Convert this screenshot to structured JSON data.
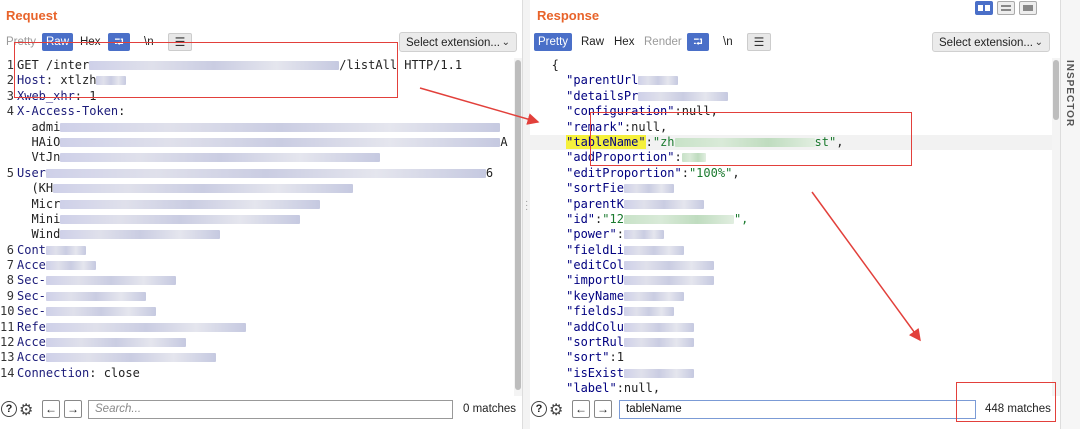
{
  "request": {
    "title": "Request",
    "tabs": [
      {
        "label": "Pretty",
        "state": "disabled"
      },
      {
        "label": "Raw",
        "state": "active"
      },
      {
        "label": "Hex",
        "state": "normal"
      }
    ],
    "newline_label": "\\n",
    "extension_select": "Select extension...",
    "lines": [
      {
        "n": "1",
        "parts": [
          {
            "t": "GET /inter"
          },
          {
            "b": 250
          },
          {
            "t": "/listAll HTTP/1.1"
          }
        ]
      },
      {
        "n": "2",
        "parts": [
          {
            "t": "Host",
            "c": "h"
          },
          {
            "t": ": xtlzh"
          },
          {
            "b": 30
          }
        ]
      },
      {
        "n": "3",
        "parts": [
          {
            "t": "Xweb_xhr",
            "c": "h"
          },
          {
            "t": ": 1"
          }
        ]
      },
      {
        "n": "4",
        "parts": [
          {
            "t": "X-Access-Token",
            "c": "h"
          },
          {
            "t": ":"
          }
        ]
      },
      {
        "n": "",
        "parts": [
          {
            "t": "  admi"
          },
          {
            "b": 440
          }
        ]
      },
      {
        "n": "",
        "parts": [
          {
            "t": "  HAiO"
          },
          {
            "b": 440
          },
          {
            "t": "A"
          }
        ]
      },
      {
        "n": "",
        "parts": [
          {
            "t": "  VtJn"
          },
          {
            "b": 320
          }
        ]
      },
      {
        "n": "5",
        "parts": [
          {
            "t": "User",
            "c": "h"
          },
          {
            "b": 440
          },
          {
            "t": "6"
          }
        ]
      },
      {
        "n": "",
        "parts": [
          {
            "t": "  (KH"
          },
          {
            "b": 300
          }
        ]
      },
      {
        "n": "",
        "parts": [
          {
            "t": "  Micr"
          },
          {
            "b": 260
          }
        ]
      },
      {
        "n": "",
        "parts": [
          {
            "t": "  Mini"
          },
          {
            "b": 240
          }
        ]
      },
      {
        "n": "",
        "parts": [
          {
            "t": "  Wind"
          },
          {
            "b": 160
          }
        ]
      },
      {
        "n": "6",
        "parts": [
          {
            "t": "Cont",
            "c": "h"
          },
          {
            "b": 40
          }
        ]
      },
      {
        "n": "7",
        "parts": [
          {
            "t": "Acce",
            "c": "h"
          },
          {
            "b": 50
          }
        ]
      },
      {
        "n": "8",
        "parts": [
          {
            "t": "Sec-",
            "c": "h"
          },
          {
            "b": 130
          }
        ]
      },
      {
        "n": "9",
        "parts": [
          {
            "t": "Sec-",
            "c": "h"
          },
          {
            "b": 100
          }
        ]
      },
      {
        "n": "10",
        "parts": [
          {
            "t": "Sec-",
            "c": "h"
          },
          {
            "b": 110
          }
        ]
      },
      {
        "n": "11",
        "parts": [
          {
            "t": "Refe",
            "c": "h"
          },
          {
            "b": 200
          }
        ]
      },
      {
        "n": "12",
        "parts": [
          {
            "t": "Acce",
            "c": "h"
          },
          {
            "b": 140
          }
        ]
      },
      {
        "n": "13",
        "parts": [
          {
            "t": "Acce",
            "c": "h"
          },
          {
            "b": 170
          }
        ]
      },
      {
        "n": "14",
        "parts": [
          {
            "t": "Connection",
            "c": "h"
          },
          {
            "t": ": close"
          }
        ]
      }
    ],
    "search_placeholder": "Search...",
    "search_value": "",
    "matches": "0 matches"
  },
  "response": {
    "title": "Response",
    "tabs": [
      {
        "label": "Pretty",
        "state": "active"
      },
      {
        "label": "Raw",
        "state": "normal"
      },
      {
        "label": "Hex",
        "state": "normal"
      },
      {
        "label": "Render",
        "state": "disabled"
      }
    ],
    "newline_label": "\\n",
    "extension_select": "Select extension...",
    "lines": [
      {
        "parts": [
          {
            "t": "   {"
          }
        ]
      },
      {
        "parts": [
          {
            "t": "     "
          },
          {
            "t": "\"parentUrl",
            "c": "k"
          },
          {
            "b": 40
          }
        ]
      },
      {
        "parts": [
          {
            "t": "     "
          },
          {
            "t": "\"detailsPr",
            "c": "k"
          },
          {
            "b": 90
          }
        ]
      },
      {
        "parts": [
          {
            "t": "     "
          },
          {
            "t": "\"configuration\"",
            "c": "k"
          },
          {
            "t": ":null,"
          }
        ]
      },
      {
        "parts": [
          {
            "t": "     "
          },
          {
            "t": "\"remark\"",
            "c": "k"
          },
          {
            "t": ":null,"
          }
        ]
      },
      {
        "hl": true,
        "parts": [
          {
            "t": "     "
          },
          {
            "t": "\"tableName\"",
            "c": "k",
            "mark": true
          },
          {
            "t": ":"
          },
          {
            "t": "\"zh",
            "c": "s"
          },
          {
            "bg": 140
          },
          {
            "t": "st\"",
            "c": "s"
          },
          {
            "t": ","
          }
        ]
      },
      {
        "parts": [
          {
            "t": "     "
          },
          {
            "t": "\"addProportion\"",
            "c": "k"
          },
          {
            "t": ":"
          },
          {
            "bg": 24
          }
        ]
      },
      {
        "parts": [
          {
            "t": "     "
          },
          {
            "t": "\"editProportion\"",
            "c": "k"
          },
          {
            "t": ":"
          },
          {
            "t": "\"100%\"",
            "c": "s"
          },
          {
            "t": ","
          }
        ]
      },
      {
        "parts": [
          {
            "t": "     "
          },
          {
            "t": "\"sortFie",
            "c": "k"
          },
          {
            "b": 50
          }
        ]
      },
      {
        "parts": [
          {
            "t": "     "
          },
          {
            "t": "\"parentK",
            "c": "k"
          },
          {
            "b": 80
          }
        ]
      },
      {
        "parts": [
          {
            "t": "     "
          },
          {
            "t": "\"id\"",
            "c": "k"
          },
          {
            "t": ":"
          },
          {
            "t": "\"12",
            "c": "s"
          },
          {
            "bg": 110
          },
          {
            "t": "\",",
            "c": "s"
          }
        ]
      },
      {
        "parts": [
          {
            "t": "     "
          },
          {
            "t": "\"power\"",
            "c": "k"
          },
          {
            "t": ":"
          },
          {
            "b": 40
          }
        ]
      },
      {
        "parts": [
          {
            "t": "     "
          },
          {
            "t": "\"fieldLi",
            "c": "k"
          },
          {
            "b": 60
          }
        ]
      },
      {
        "parts": [
          {
            "t": "     "
          },
          {
            "t": "\"editCol",
            "c": "k"
          },
          {
            "b": 90
          }
        ]
      },
      {
        "parts": [
          {
            "t": "     "
          },
          {
            "t": "\"importU",
            "c": "k"
          },
          {
            "b": 90
          }
        ]
      },
      {
        "parts": [
          {
            "t": "     "
          },
          {
            "t": "\"keyName",
            "c": "k"
          },
          {
            "b": 60
          }
        ]
      },
      {
        "parts": [
          {
            "t": "     "
          },
          {
            "t": "\"fieldsJ",
            "c": "k"
          },
          {
            "b": 50
          }
        ]
      },
      {
        "parts": [
          {
            "t": "     "
          },
          {
            "t": "\"addColu",
            "c": "k"
          },
          {
            "b": 70
          }
        ]
      },
      {
        "parts": [
          {
            "t": "     "
          },
          {
            "t": "\"sortRul",
            "c": "k"
          },
          {
            "b": 70
          }
        ]
      },
      {
        "parts": [
          {
            "t": "     "
          },
          {
            "t": "\"sort\"",
            "c": "k"
          },
          {
            "t": ":1"
          }
        ]
      },
      {
        "parts": [
          {
            "t": "     "
          },
          {
            "t": "\"isExist",
            "c": "k"
          },
          {
            "b": 70
          }
        ]
      },
      {
        "parts": [
          {
            "t": "     "
          },
          {
            "t": "\"label\"",
            "c": "k"
          },
          {
            "t": ":null,"
          }
        ]
      }
    ],
    "search_value": "tableName",
    "matches": "448 matches"
  },
  "inspector_label": "INSPECTOR",
  "colors": {
    "accent": "#e8632a",
    "active_tab": "#4a6fc8",
    "annotation": "#e2403b"
  }
}
